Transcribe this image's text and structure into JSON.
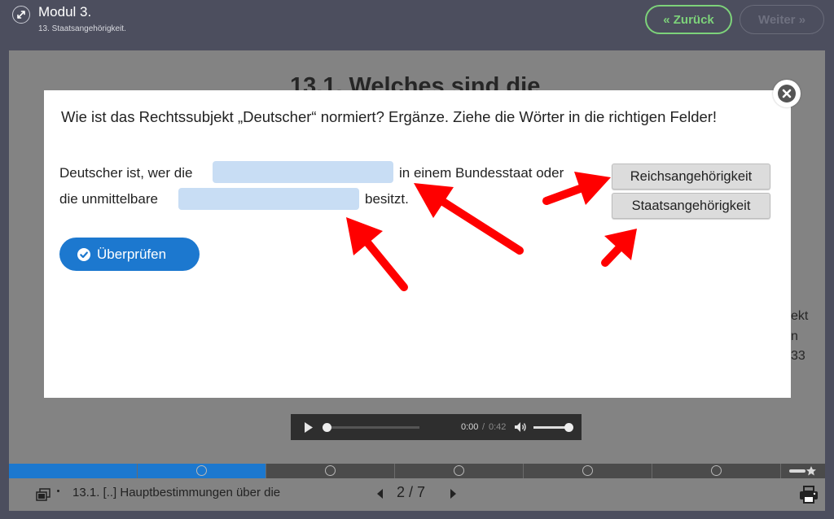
{
  "header": {
    "module_title": "Modul 3.",
    "module_subtitle": "13. Staatsangehörigkeit.",
    "back_label": "« Zurück",
    "next_label": "Weiter »"
  },
  "background": {
    "heading": "13.1. Welches sind die",
    "fragments": [
      "ekt",
      "n",
      "33"
    ]
  },
  "audio": {
    "time_current": "0:00",
    "separator": "/",
    "time_total": "0:42",
    "seek_progress": 0,
    "volume_level": 0.9
  },
  "progress": {
    "segments": 6,
    "completed_segments": 1
  },
  "footer": {
    "slide_title": "13.1. [..] Hauptbestimmungen über die",
    "pager": "2 / 7"
  },
  "modal": {
    "question": "Wie ist das Rechtssubjekt „Deutscher“ normiert? Ergänze. Ziehe die Wörter in die richtigen Felder!",
    "line1_before": "Deutscher ist, wer die",
    "line1_after": "in einem Bundesstaat oder",
    "line2_before": "die unmittelbare",
    "line2_after": "besitzt.",
    "words": [
      "Reichsangehörigkeit",
      "Staatsangehörigkeit"
    ],
    "check_label": "Überprüfen"
  },
  "colors": {
    "accent_blue": "#1c78cf",
    "back_green": "#7dd27a",
    "dropzone": "#c8ddf4",
    "arrow_red": "#ff0000"
  }
}
